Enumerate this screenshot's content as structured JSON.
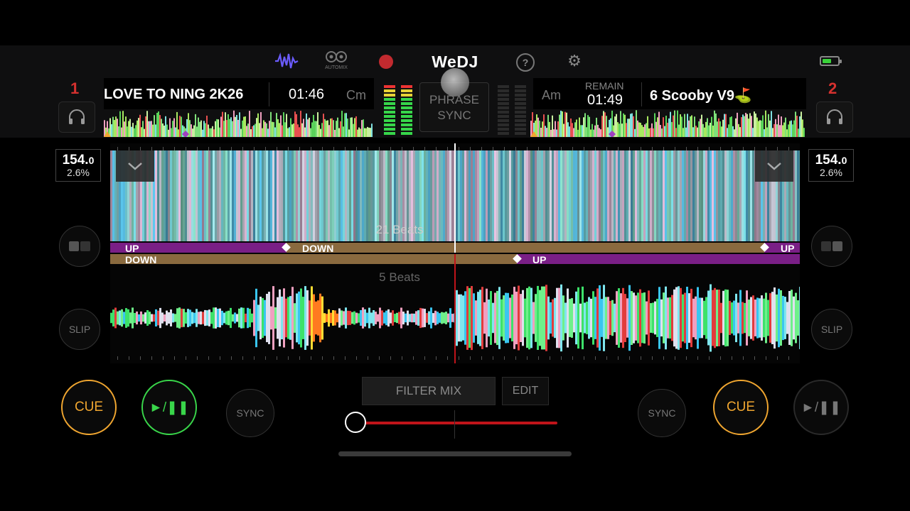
{
  "app": {
    "logo": "WeDJ",
    "automix_label": "AUTOMIX"
  },
  "header": {
    "help": "?",
    "settings_icon": "gear-icon",
    "record_color": "#c22a2f"
  },
  "deck1": {
    "number": "1",
    "title": "LOVE TO NING 2K26",
    "time": "01:46",
    "key": "Cm",
    "bpm_main": "154.",
    "bpm_dec": "0",
    "pitch": "2.6%",
    "slip": "SLIP",
    "cue": "CUE",
    "play": "►/❚❚",
    "sync": "SYNC"
  },
  "deck2": {
    "number": "2",
    "title": "6 Scooby V9⛳",
    "key": "Am",
    "remain_label": "REMAIN",
    "time": "01:49",
    "bpm_main": "154.",
    "bpm_dec": "0",
    "pitch": "2.6%",
    "slip": "SLIP",
    "cue": "CUE",
    "play": "►/❚❚",
    "sync": "SYNC"
  },
  "center": {
    "phrase_sync": [
      "PHRASE",
      "SYNC"
    ],
    "beats_top": "21 Beats",
    "beats_bottom": "5 Beats",
    "filter_mix": "FILTER MIX",
    "edit": "EDIT",
    "crossfader": 0.0
  },
  "phrases": {
    "top": [
      {
        "label": "UP"
      },
      {
        "label": "DOWN"
      },
      {
        "label": "UP"
      }
    ],
    "bottom": [
      {
        "label": "DOWN"
      },
      {
        "label": "UP"
      }
    ]
  },
  "colors": {
    "cue": "#f0a630",
    "play_active": "#39d64a",
    "accent_red": "#d5312f",
    "phrase_up": "#7a1f86",
    "phrase_down": "#8a6a3f"
  }
}
